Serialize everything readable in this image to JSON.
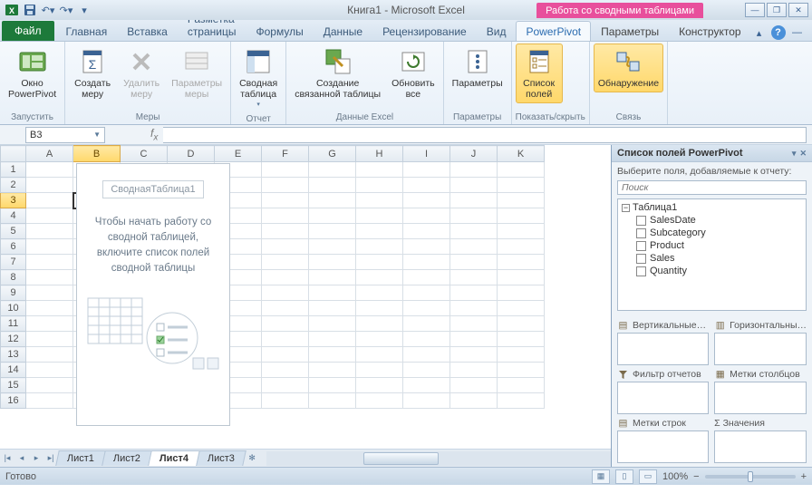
{
  "title": "Книга1 - Microsoft Excel",
  "contextual_title": "Работа со сводными таблицами",
  "tabs": {
    "file": "Файл",
    "items": [
      "Главная",
      "Вставка",
      "Разметка страницы",
      "Формулы",
      "Данные",
      "Рецензирование",
      "Вид",
      "PowerPivot"
    ],
    "context": [
      "Параметры",
      "Конструктор"
    ],
    "active": "PowerPivot"
  },
  "ribbon": {
    "groups": [
      {
        "label": "Запустить",
        "buttons": [
          {
            "key": "pp-window",
            "text": "Окно\nPowerPivot"
          }
        ]
      },
      {
        "label": "Меры",
        "buttons": [
          {
            "key": "new-measure",
            "text": "Создать\nмеру"
          },
          {
            "key": "del-measure",
            "text": "Удалить\nмеру",
            "disabled": true
          },
          {
            "key": "measure-params",
            "text": "Параметры\nмеры",
            "disabled": true
          }
        ]
      },
      {
        "label": "Отчет",
        "buttons": [
          {
            "key": "pivot",
            "text": "Сводная\nтаблица",
            "drop": true
          }
        ]
      },
      {
        "label": "Данные Excel",
        "buttons": [
          {
            "key": "linked-table",
            "text": "Создание\nсвязанной таблицы"
          },
          {
            "key": "refresh-all",
            "text": "Обновить\nвсе"
          }
        ]
      },
      {
        "label": "Параметры",
        "buttons": [
          {
            "key": "params",
            "text": "Параметры"
          }
        ]
      },
      {
        "label": "Показать/скрыть",
        "buttons": [
          {
            "key": "field-list",
            "text": "Список\nполей",
            "hl": true
          }
        ]
      },
      {
        "label": "Связь",
        "buttons": [
          {
            "key": "detect",
            "text": "Обнаружение",
            "hl": true
          }
        ]
      }
    ]
  },
  "name_box": "B3",
  "columns": [
    "A",
    "B",
    "C",
    "D",
    "E",
    "F",
    "G",
    "H",
    "I",
    "J",
    "K"
  ],
  "rows": [
    1,
    2,
    3,
    4,
    5,
    6,
    7,
    8,
    9,
    10,
    11,
    12,
    13,
    14,
    15,
    16
  ],
  "selected": {
    "col": "B",
    "row": 3
  },
  "pivot_placeholder": {
    "title": "СводнаяТаблица1",
    "text": "Чтобы начать работу со сводной таблицей, включите список полей сводной таблицы"
  },
  "sheets": {
    "items": [
      "Лист1",
      "Лист2",
      "Лист4",
      "Лист3"
    ],
    "active": "Лист4"
  },
  "pane": {
    "title": "Список полей PowerPivot",
    "subtitle": "Выберите поля, добавляемые к отчету:",
    "search_placeholder": "Поиск",
    "table": "Таблица1",
    "fields": [
      "SalesDate",
      "Subcategory",
      "Product",
      "Sales",
      "Quantity"
    ],
    "areas": {
      "vslicers": "Вертикальные…",
      "hslicers": "Горизонтальны…",
      "report_filter": "Фильтр отчетов",
      "col_labels": "Метки столбцов",
      "row_labels": "Метки строк",
      "values_sigma": "Σ   Значения"
    }
  },
  "status": {
    "ready": "Готово",
    "zoom": "100%"
  }
}
